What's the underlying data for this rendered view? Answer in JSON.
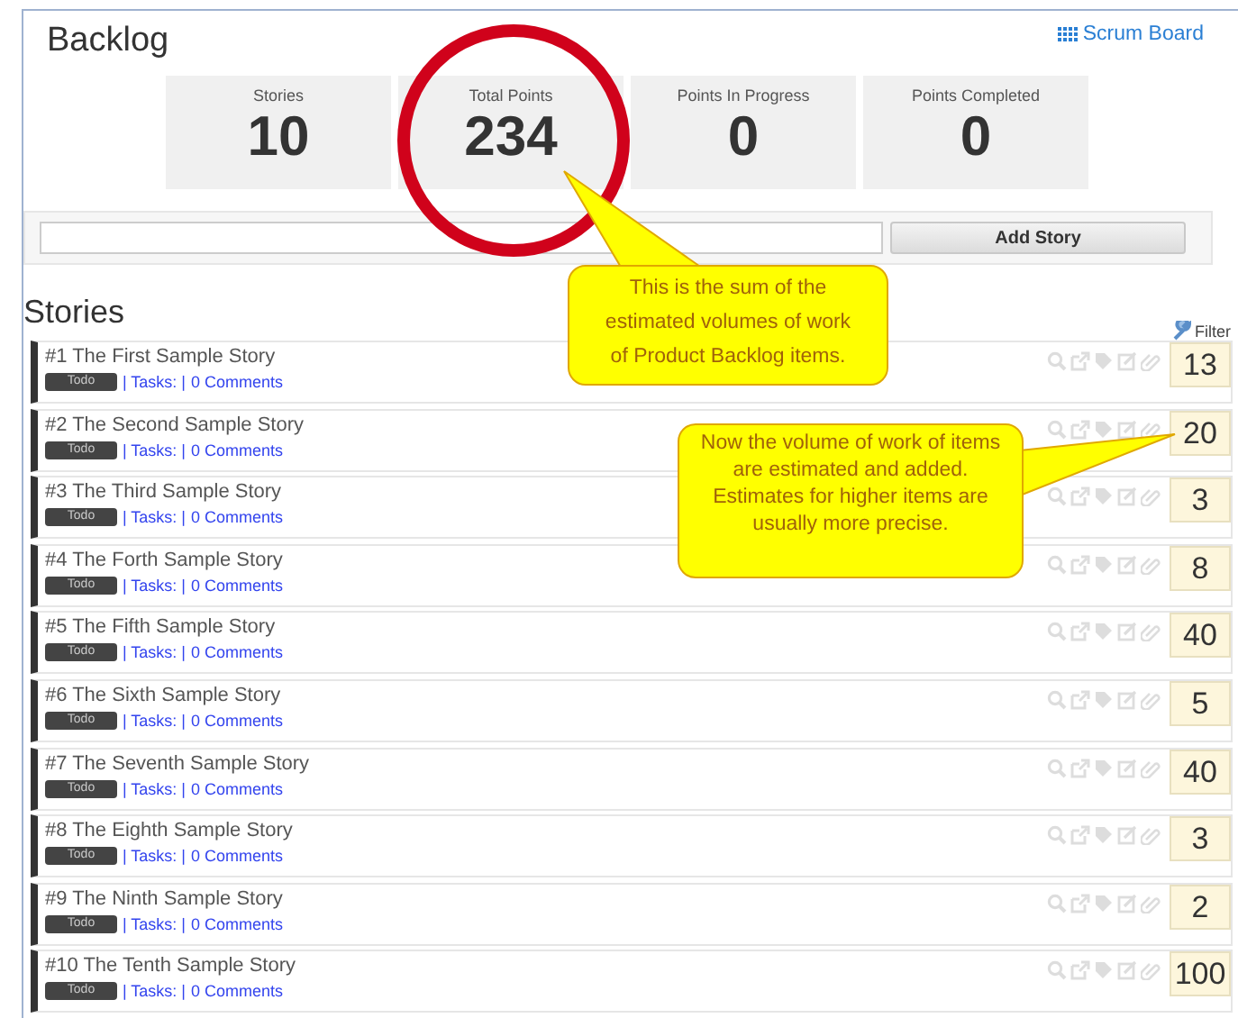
{
  "page": {
    "title": "Backlog",
    "scrum_board_link": "Scrum Board"
  },
  "stats": [
    {
      "label": "Stories",
      "value": "10"
    },
    {
      "label": "Total Points",
      "value": "234"
    },
    {
      "label": "Points In Progress",
      "value": "0"
    },
    {
      "label": "Points Completed",
      "value": "0"
    }
  ],
  "add_story": {
    "button": "Add Story"
  },
  "stories_section": {
    "heading": "Stories",
    "filter": "Filter"
  },
  "stories": [
    {
      "title": "#1 The First Sample Story",
      "status": "Todo",
      "tasks": "| Tasks: |",
      "comments": "0 Comments",
      "points": "13"
    },
    {
      "title": "#2 The Second Sample Story",
      "status": "Todo",
      "tasks": "| Tasks: |",
      "comments": "0 Comments",
      "points": "20"
    },
    {
      "title": "#3 The Third Sample Story",
      "status": "Todo",
      "tasks": "| Tasks: |",
      "comments": "0 Comments",
      "points": "3"
    },
    {
      "title": "#4 The Forth Sample Story",
      "status": "Todo",
      "tasks": "| Tasks: |",
      "comments": "0 Comments",
      "points": "8"
    },
    {
      "title": "#5 The Fifth Sample Story",
      "status": "Todo",
      "tasks": "| Tasks: |",
      "comments": "0 Comments",
      "points": "40"
    },
    {
      "title": "#6 The Sixth Sample Story",
      "status": "Todo",
      "tasks": "| Tasks: |",
      "comments": "0 Comments",
      "points": "5"
    },
    {
      "title": "#7 The Seventh Sample Story",
      "status": "Todo",
      "tasks": "| Tasks: |",
      "comments": "0 Comments",
      "points": "40"
    },
    {
      "title": "#8 The Eighth Sample Story",
      "status": "Todo",
      "tasks": "| Tasks: |",
      "comments": "0 Comments",
      "points": "3"
    },
    {
      "title": "#9 The Ninth Sample Story",
      "status": "Todo",
      "tasks": "| Tasks: |",
      "comments": "0 Comments",
      "points": "2"
    },
    {
      "title": "#10 The Tenth Sample Story",
      "status": "Todo",
      "tasks": "| Tasks: |",
      "comments": "0 Comments",
      "points": "100"
    }
  ],
  "annotations": [
    {
      "text": "This is the sum of the estimated volumes of work of Product Backlog items."
    },
    {
      "text": "Now the volume of work of items are estimated and added. Estimates for higher items are usually more precise."
    }
  ]
}
